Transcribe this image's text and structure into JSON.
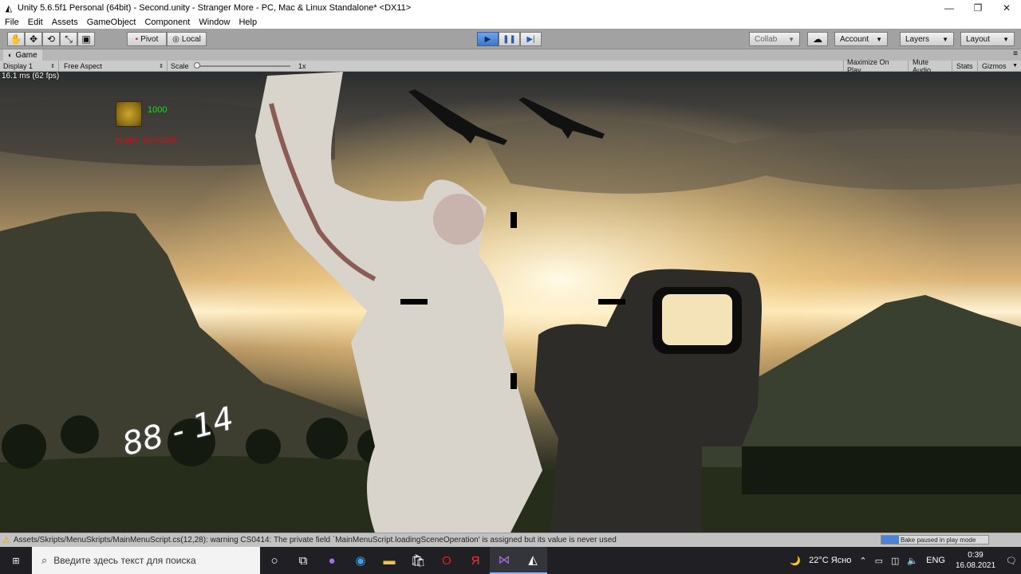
{
  "window": {
    "title": "Unity 5.6.5f1 Personal (64bit) - Second.unity - Stranger More - PC, Mac & Linux Standalone* <DX11>",
    "minimize": "—",
    "maximize": "❐",
    "close": "✕"
  },
  "menu": [
    "File",
    "Edit",
    "Assets",
    "GameObject",
    "Component",
    "Window",
    "Help"
  ],
  "toolbar": {
    "pivot_label": "Pivot",
    "local_label": "Local",
    "collab_label": "Collab",
    "account_label": "Account",
    "layers_label": "Layers",
    "layout_label": "Layout"
  },
  "game_tab": {
    "label": "Game",
    "display": "Display 1",
    "aspect": "Free Aspect",
    "scale_label": "Scale",
    "scale_value": "1x",
    "maximize_on_play": "Maximize On Play",
    "mute_audio": "Mute Audio",
    "stats": "Stats",
    "gizmos": "Gizmos"
  },
  "game": {
    "fps": "16.1 ms (62 fps)",
    "score": "1000",
    "health": "Health: 900/1000",
    "ammo": "88 - 14"
  },
  "status": {
    "warning": "Assets/Skripts/MenuSkripts/MainMenuScript.cs(12,28): warning CS0414: The private field `MainMenuScript.loadingSceneOperation' is assigned but its value is never used",
    "bake": "Bake paused in play mode"
  },
  "taskbar": {
    "search_placeholder": "Введите здесь текст для поиска",
    "weather": "22°C Ясно",
    "lang": "ENG",
    "time": "0:39",
    "date": "16.08.2021"
  }
}
